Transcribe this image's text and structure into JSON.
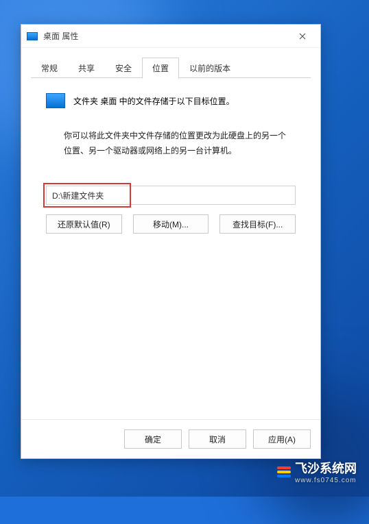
{
  "window": {
    "title": "桌面 属性"
  },
  "tabs": {
    "general": "常规",
    "share": "共享",
    "security": "安全",
    "location": "位置",
    "previous": "以前的版本"
  },
  "content": {
    "header": "文件夹 桌面 中的文件存储于以下目标位置。",
    "desc_line1": "你可以将此文件夹中文件存储的位置更改为此硬盘上的另一个",
    "desc_line2": "位置、另一个驱动器或网络上的另一台计算机。",
    "path_value": "D:\\新建文件夹",
    "restore_btn": "还原默认值(R)",
    "move_btn": "移动(M)...",
    "find_btn": "查找目标(F)..."
  },
  "footer": {
    "ok": "确定",
    "cancel": "取消",
    "apply": "应用(A)"
  },
  "watermark": {
    "brand": "飞沙系统网",
    "url": "www.fs0745.com"
  }
}
